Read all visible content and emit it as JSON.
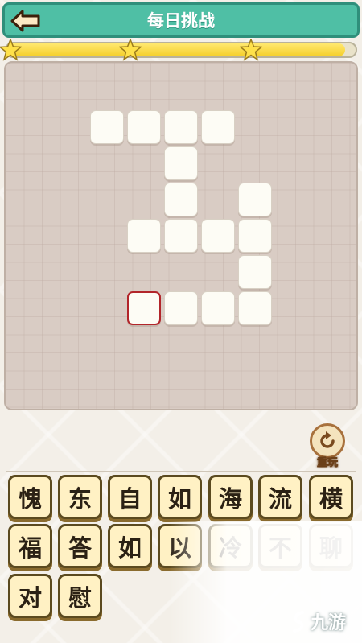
{
  "header": {
    "title": "每日挑战",
    "back_icon": "back-arrow-icon",
    "color": "#4fbfa5"
  },
  "progress": {
    "value": 0.97,
    "stars": 3,
    "star_icon": "star-icon"
  },
  "board": {
    "selected_cell": 0
  },
  "replay": {
    "label": "重玩",
    "icon": "replay-icon"
  },
  "tiles": [
    "愧",
    "东",
    "自",
    "如",
    "海",
    "流",
    "横",
    "福",
    "答",
    "如",
    "以",
    "冷",
    "不",
    "聊",
    "对",
    "慰"
  ],
  "watermark": {
    "brand": "九游"
  }
}
